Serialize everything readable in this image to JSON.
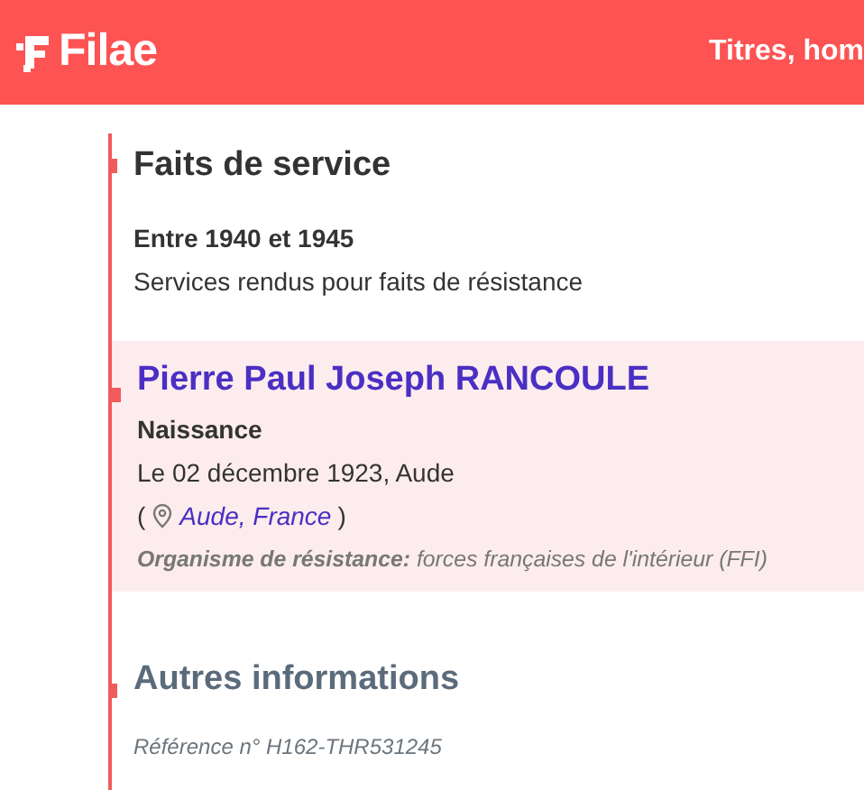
{
  "header": {
    "logo": "Filae",
    "nav_text": "Titres, hom"
  },
  "service": {
    "title": "Faits de service",
    "period": "Entre 1940 et 1945",
    "description": "Services rendus pour faits de résistance"
  },
  "person": {
    "name": "Pierre Paul Joseph RANCOULE",
    "event": "Naissance",
    "date": "Le 02 décembre 1923, Aude",
    "paren_open": "(",
    "place": "Aude, France",
    "paren_close": ")",
    "organisation_label": "Organisme de résistance:",
    "organisation": "forces françaises de l'intérieur (FFI)"
  },
  "other": {
    "title": "Autres informations",
    "reference": "Référence n° H162-THR531245"
  }
}
